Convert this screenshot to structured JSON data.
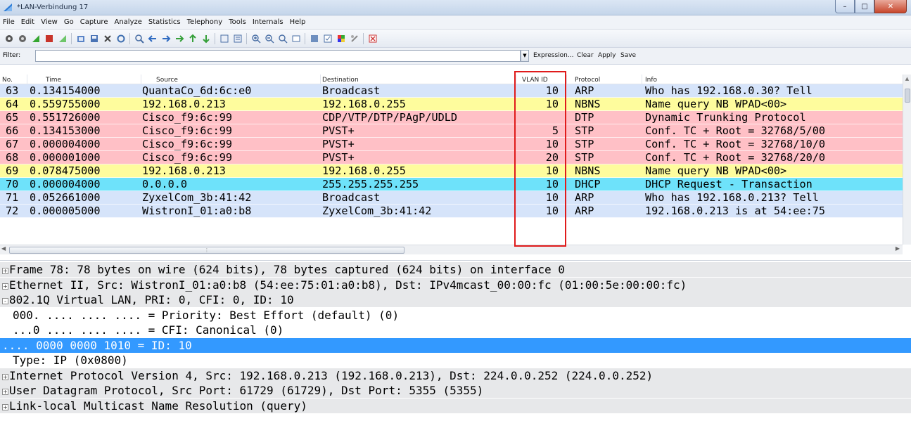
{
  "window": {
    "title": "*LAN-Verbindung 17"
  },
  "menu": [
    "File",
    "Edit",
    "View",
    "Go",
    "Capture",
    "Analyze",
    "Statistics",
    "Telephony",
    "Tools",
    "Internals",
    "Help"
  ],
  "filter": {
    "label": "Filter:",
    "value": "",
    "expression": "Expression...",
    "clear": "Clear",
    "apply": "Apply",
    "save": "Save"
  },
  "columns": {
    "no": "No.",
    "time": "Time",
    "source": "Source",
    "destination": "Destination",
    "vlan": "VLAN ID",
    "protocol": "Protocol",
    "info": "Info"
  },
  "colors": {
    "arp": "#d6e4fa",
    "nbns": "#fefc9d",
    "stp": "#ffc0c6",
    "dhcp": "#6ee2fa",
    "highlight_box": "#e01b1b",
    "selected": "#3399ff"
  },
  "packets": [
    {
      "no": "63",
      "time": "0.134154000",
      "src": "QuantaCo_6d:6c:e0",
      "dst": "Broadcast",
      "vlan": "10",
      "proto": "ARP",
      "info": "Who has 192.168.0.30?  Tell",
      "color": "arp"
    },
    {
      "no": "64",
      "time": "0.559755000",
      "src": "192.168.0.213",
      "dst": "192.168.0.255",
      "vlan": "10",
      "proto": "NBNS",
      "info": "Name query NB WPAD<00>",
      "color": "nbns"
    },
    {
      "no": "65",
      "time": "0.551726000",
      "src": "Cisco_f9:6c:99",
      "dst": "CDP/VTP/DTP/PAgP/UDLD",
      "vlan": "",
      "proto": "DTP",
      "info": "Dynamic Trunking Protocol",
      "color": "stp"
    },
    {
      "no": "66",
      "time": "0.134153000",
      "src": "Cisco_f9:6c:99",
      "dst": "PVST+",
      "vlan": "5",
      "proto": "STP",
      "info": "Conf. TC + Root = 32768/5/00",
      "color": "stp"
    },
    {
      "no": "67",
      "time": "0.000004000",
      "src": "Cisco_f9:6c:99",
      "dst": "PVST+",
      "vlan": "10",
      "proto": "STP",
      "info": "Conf. TC + Root = 32768/10/0",
      "color": "stp"
    },
    {
      "no": "68",
      "time": "0.000001000",
      "src": "Cisco_f9:6c:99",
      "dst": "PVST+",
      "vlan": "20",
      "proto": "STP",
      "info": "Conf. TC + Root = 32768/20/0",
      "color": "stp"
    },
    {
      "no": "69",
      "time": "0.078475000",
      "src": "192.168.0.213",
      "dst": "192.168.0.255",
      "vlan": "10",
      "proto": "NBNS",
      "info": "Name query NB WPAD<00>",
      "color": "nbns"
    },
    {
      "no": "70",
      "time": "0.000004000",
      "src": "0.0.0.0",
      "dst": "255.255.255.255",
      "vlan": "10",
      "proto": "DHCP",
      "info": "DHCP Request  - Transaction",
      "color": "dhcp"
    },
    {
      "no": "71",
      "time": "0.052661000",
      "src": "ZyxelCom_3b:41:42",
      "dst": "Broadcast",
      "vlan": "10",
      "proto": "ARP",
      "info": "Who has 192.168.0.213?  Tell",
      "color": "arp"
    },
    {
      "no": "72",
      "time": "0.000005000",
      "src": "WistronI_01:a0:b8",
      "dst": "ZyxelCom_3b:41:42",
      "vlan": "10",
      "proto": "ARP",
      "info": "192.168.0.213 is at 54:ee:75",
      "color": "arp"
    }
  ],
  "details": [
    {
      "text": "Frame 78: 78 bytes on wire (624 bits), 78 bytes captured (624 bits) on interface 0",
      "toggle": "+",
      "kind": "header"
    },
    {
      "text": "Ethernet II, Src: WistronI_01:a0:b8 (54:ee:75:01:a0:b8), Dst: IPv4mcast_00:00:fc (01:00:5e:00:00:fc)",
      "toggle": "+",
      "kind": "header"
    },
    {
      "text": "802.1Q Virtual LAN, PRI: 0, CFI: 0, ID: 10",
      "toggle": "-",
      "kind": "header"
    },
    {
      "text": "000. .... .... .... = Priority: Best Effort (default) (0)",
      "toggle": "",
      "kind": "child"
    },
    {
      "text": "...0 .... .... .... = CFI: Canonical (0)",
      "toggle": "",
      "kind": "child"
    },
    {
      "text": ".... 0000 0000 1010 = ID: 10",
      "toggle": "",
      "kind": "selected"
    },
    {
      "text": "Type: IP (0x0800)",
      "toggle": "",
      "kind": "child"
    },
    {
      "text": "Internet Protocol Version 4, Src: 192.168.0.213 (192.168.0.213), Dst: 224.0.0.252 (224.0.0.252)",
      "toggle": "+",
      "kind": "header"
    },
    {
      "text": "User Datagram Protocol, Src Port: 61729 (61729), Dst Port: 5355 (5355)",
      "toggle": "+",
      "kind": "header"
    },
    {
      "text": "Link-local Multicast Name Resolution (query)",
      "toggle": "+",
      "kind": "header"
    }
  ]
}
